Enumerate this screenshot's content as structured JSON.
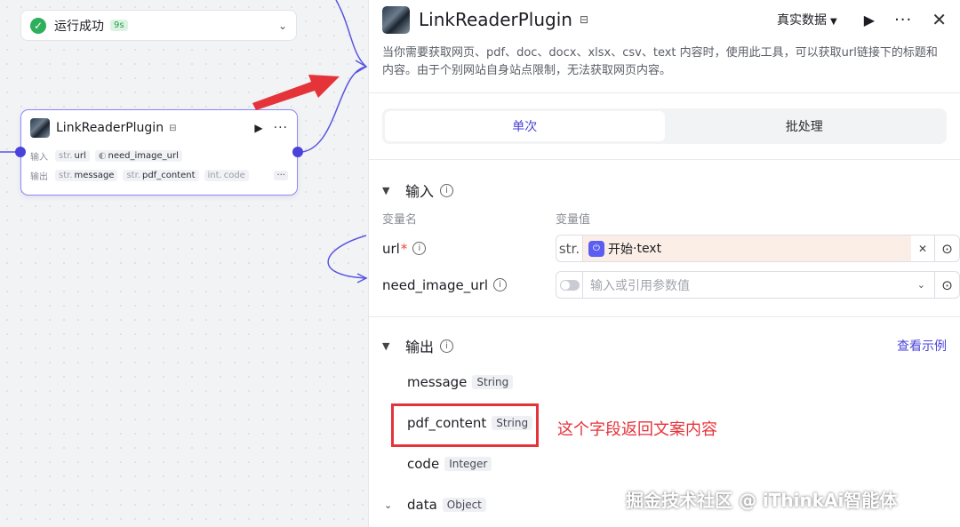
{
  "run_status": {
    "label": "运行成功",
    "duration": "9s"
  },
  "node": {
    "title": "LinkReaderPlugin",
    "input_label": "输入",
    "output_label": "输出",
    "inputs": [
      {
        "type": "str.",
        "name": "url"
      },
      {
        "type": "",
        "name": "need_image_url"
      }
    ],
    "outputs": [
      {
        "type": "str.",
        "name": "message"
      },
      {
        "type": "str.",
        "name": "pdf_content"
      },
      {
        "type": "int.",
        "name": "code"
      }
    ],
    "more": "···"
  },
  "panel": {
    "title": "LinkReaderPlugin",
    "mode": "真实数据",
    "description": "当你需要获取网页、pdf、doc、docx、xlsx、csv、text 内容时，使用此工具，可以获取url链接下的标题和内容。由于个别网站自身站点限制，无法获取网页内容。",
    "tabs": [
      {
        "label": "单次",
        "active": true
      },
      {
        "label": "批处理",
        "active": false
      }
    ],
    "input_section": {
      "title": "输入",
      "col_name": "变量名",
      "col_value": "变量值",
      "rows": [
        {
          "name": "url",
          "required": "*",
          "type": "str.",
          "ref_source": "开始",
          "ref_sep": " · ",
          "ref_var": "text"
        },
        {
          "name": "need_image_url",
          "placeholder": "输入或引用参数值"
        }
      ]
    },
    "output_section": {
      "title": "输出",
      "link": "查看示例",
      "fields": [
        {
          "name": "message",
          "type": "String"
        },
        {
          "name": "pdf_content",
          "type": "String"
        },
        {
          "name": "code",
          "type": "Integer"
        },
        {
          "name": "data",
          "type": "Object"
        }
      ]
    }
  },
  "annotation": "这个字段返回文案内容",
  "watermark": "掘金技术社区 @ iThinkAi智能体",
  "colors": {
    "accent": "#4a43d9",
    "annotation": "#e5333a",
    "success": "#2fae5b"
  }
}
